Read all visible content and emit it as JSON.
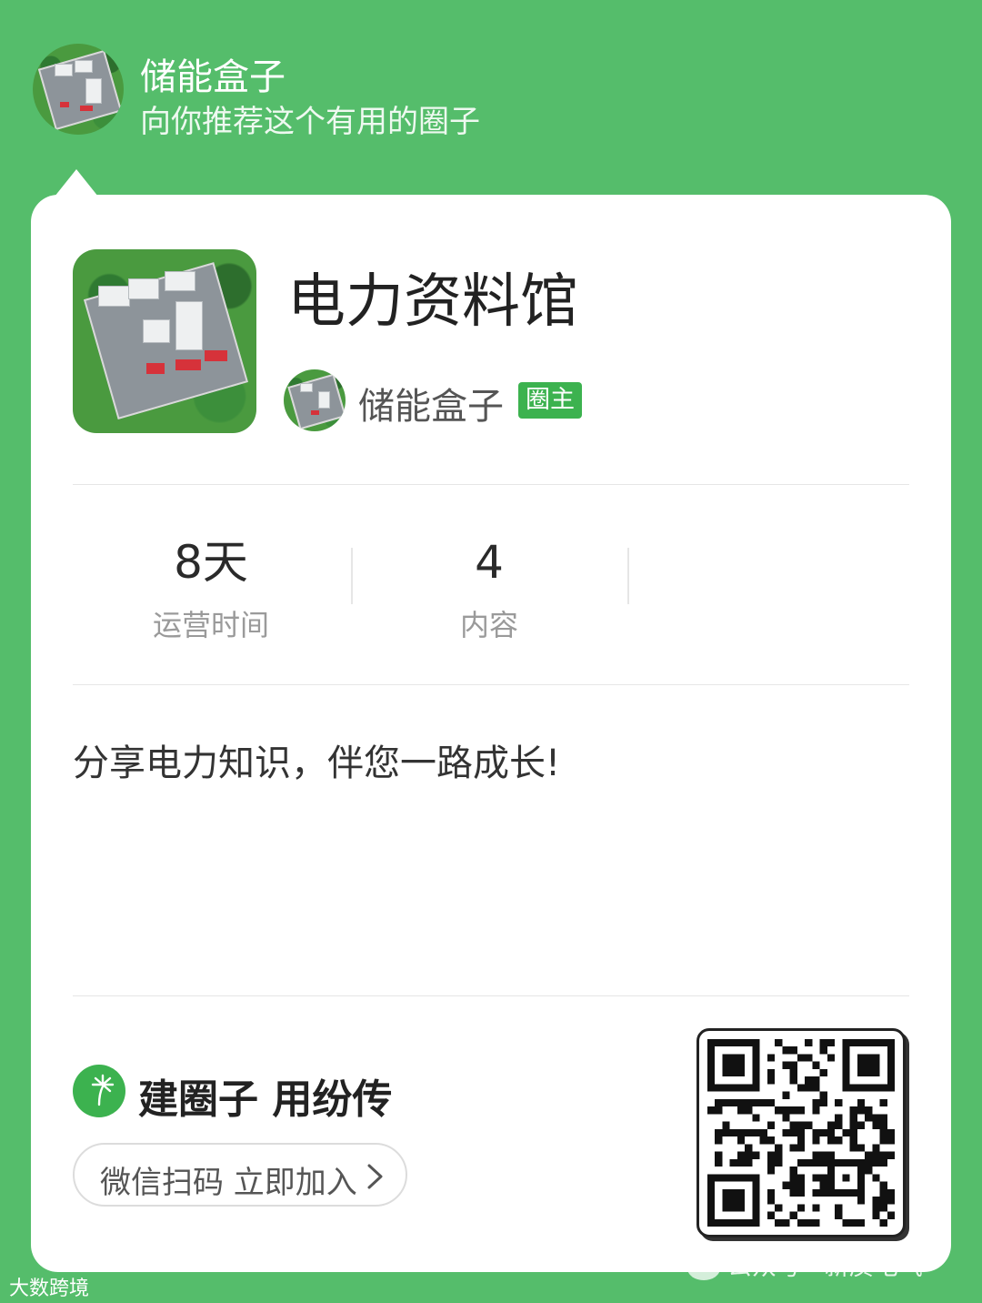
{
  "header": {
    "sender_name": "储能盒子",
    "subtitle": "向你推荐这个有用的圈子"
  },
  "circle": {
    "title": "电力资料馆",
    "owner_name": "储能盒子",
    "owner_badge": "圈主",
    "description": "分享电力知识，伴您一路成长!"
  },
  "stats": [
    {
      "value": "8天",
      "label": "运营时间"
    },
    {
      "value": "4",
      "label": "内容"
    }
  ],
  "footer": {
    "brand": "建圈子 用纷传",
    "join_label": "微信扫码 立即加入",
    "qr_icon": "qr-code"
  },
  "watermarks": {
    "account": "公众号 · 新质电气",
    "corner": "大数跨境"
  },
  "colors": {
    "background": "#55bd6b",
    "accent": "#3cb24f"
  }
}
